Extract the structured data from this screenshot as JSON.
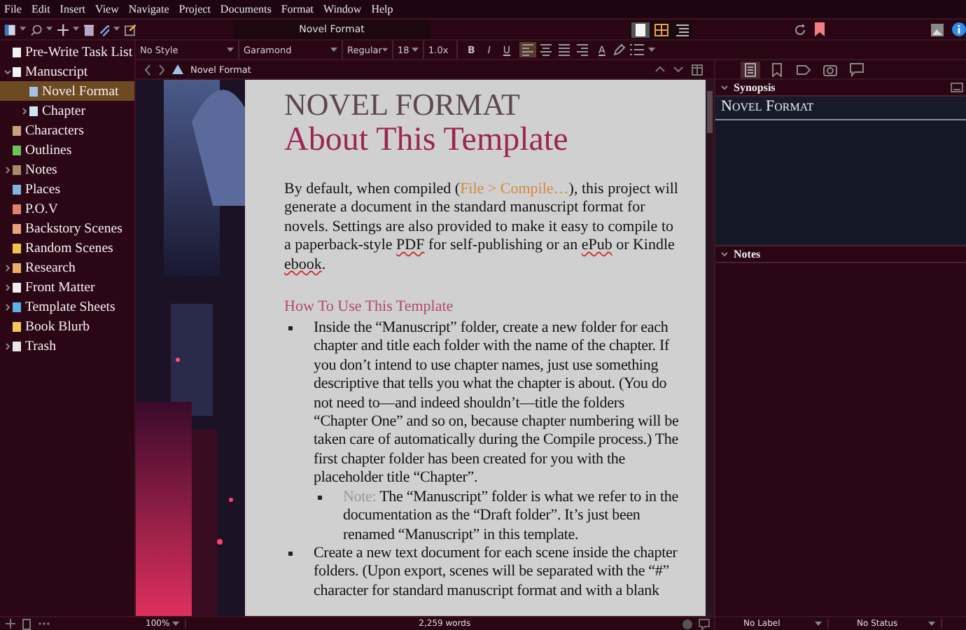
{
  "menu": [
    "File",
    "Edit",
    "Insert",
    "View",
    "Navigate",
    "Project",
    "Documents",
    "Format",
    "Window",
    "Help"
  ],
  "toolbar": {
    "title": "Novel Format",
    "view_modes": [
      {
        "selected": true
      },
      {
        "selected": false
      },
      {
        "selected": false
      }
    ]
  },
  "binder": {
    "items": [
      {
        "label": "Pre-Write Task List",
        "color": "#f2f2f2",
        "selected": false
      },
      {
        "label": "Manuscript",
        "color": "#f2f2f2",
        "selected": false,
        "expanded": true,
        "children": [
          {
            "label": "Novel Format",
            "color": "#9ec3e6",
            "selected": true
          },
          {
            "label": "Chapter",
            "color": "#cfe3f5",
            "selected": false,
            "expanded": false
          }
        ]
      },
      {
        "label": "Characters",
        "color": "#c9a27a",
        "selected": false
      },
      {
        "label": "Outlines",
        "color": "#6cc35a",
        "selected": false
      },
      {
        "label": "Notes",
        "color": "#a8896a",
        "selected": false,
        "expanded": false
      },
      {
        "label": "Places",
        "color": "#7fb4e0",
        "selected": false
      },
      {
        "label": "P.O.V",
        "color": "#e0806e",
        "selected": false
      },
      {
        "label": "Backstory Scenes",
        "color": "#e8a27a",
        "selected": false
      },
      {
        "label": "Random Scenes",
        "color": "#f0c44a",
        "selected": false
      },
      {
        "label": "Research",
        "color": "#e8b06a",
        "selected": false,
        "expanded": false
      },
      {
        "label": "Front Matter",
        "color": "#eeeeee",
        "selected": false,
        "expanded": false
      },
      {
        "label": "Template Sheets",
        "color": "#5ab4e8",
        "selected": false,
        "expanded": false
      },
      {
        "label": "Book Blurb",
        "color": "#f2c85a",
        "selected": false
      },
      {
        "label": "Trash",
        "color": "#e6e6e6",
        "selected": false,
        "expanded": false
      }
    ]
  },
  "format_bar": {
    "style": "No Style",
    "font": "Garamond",
    "weight": "Regular",
    "size": "18",
    "line_spacing": "1.0x",
    "buttons": [
      "B",
      "I",
      "U"
    ],
    "alignment": [
      {
        "selected": true
      },
      {
        "selected": false
      },
      {
        "selected": false
      },
      {
        "selected": false
      }
    ],
    "color_button": "A"
  },
  "header": {
    "title": "Novel Format"
  },
  "document": {
    "title": "NOVEL FORMAT",
    "heading": "About This Template",
    "intro": [
      {
        "kind": "plain",
        "text": "By default, when compiled ("
      },
      {
        "kind": "menu_path",
        "text": "File > Compile…"
      },
      {
        "kind": "plain",
        "text": "), this project will generate a document in the standard manuscript format for novels. Settings are also provided to make it easy to compile to a paperback-style "
      },
      {
        "kind": "misspelled",
        "text": "PDF"
      },
      {
        "kind": "plain",
        "text": " for self-publishing or an "
      },
      {
        "kind": "misspelled",
        "text": "ePub"
      },
      {
        "kind": "plain",
        "text": " or Kindle "
      },
      {
        "kind": "misspelled",
        "text": "ebook"
      },
      {
        "kind": "plain",
        "text": "."
      }
    ],
    "section_heading": "How To Use This Template",
    "bullets": [
      {
        "segments": [
          {
            "kind": "plain",
            "text": "Inside the “Manuscript” folder, create a new folder for each chapter and title each folder with the name of the chapter. If you don’t intend to use chapter names, just use something descriptive that tells you what the chapter is about. (You do not need to—and indeed shouldn’t—title the folders “Chapter One” and so on, because chapter numbering will be taken care of automatically during the Compile process.) The first chapter folder has been created for you with the placeholder title “Chapter”."
          }
        ],
        "children": [
          {
            "segments": [
              {
                "kind": "note",
                "text": "Note:"
              },
              {
                "kind": "plain",
                "text": " The “Manuscript” folder is what we refer to in the documentation as the “Draft folder”. It’s just been renamed “Manuscript” in this template."
              }
            ]
          }
        ]
      },
      {
        "segments": [
          {
            "kind": "plain",
            "text": "Create a new text document for each scene inside the chapter folders. (Upon export, scenes will be separated with the “#” character for standard manuscript format and with a blank"
          }
        ]
      }
    ]
  },
  "inspector": {
    "tabs": [
      {
        "selected": true
      },
      {
        "selected": false
      },
      {
        "selected": false
      },
      {
        "selected": false
      },
      {
        "selected": false
      }
    ],
    "synopsis": {
      "header": "Synopsis",
      "title": "Novel Format"
    },
    "notes": {
      "header": "Notes"
    }
  },
  "footer": {
    "zoom": "100%",
    "word_count": "2,259 words",
    "label": "No Label",
    "status": "No Status"
  }
}
